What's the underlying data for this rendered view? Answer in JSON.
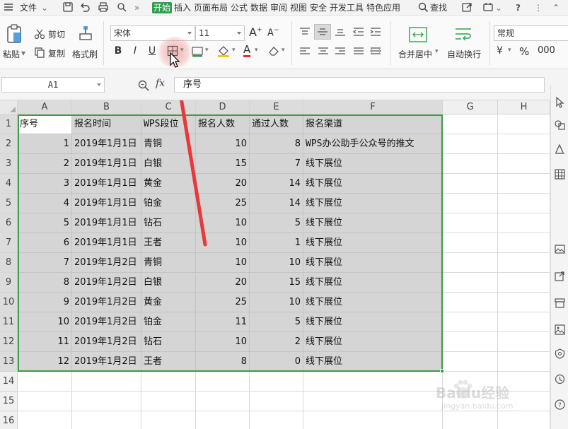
{
  "menubar": {
    "file_label": "文件",
    "tabs": [
      "开始",
      "插入",
      "页面布局",
      "公式",
      "数据",
      "审阅",
      "视图",
      "安全",
      "开发工具",
      "特色应用"
    ],
    "search_label": "查找"
  },
  "ribbon": {
    "paste_label": "粘贴",
    "cut_label": "剪切",
    "copy_label": "复制",
    "format_painter_label": "格式刷",
    "font_name": "宋体",
    "font_size": "11",
    "merge_center_label": "合并居中",
    "wrap_text_label": "自动换行",
    "number_format": "常规"
  },
  "formula_bar": {
    "name_box": "A1",
    "fx_label": "fx",
    "content": "序号"
  },
  "sheet": {
    "columns": [
      "A",
      "B",
      "C",
      "D",
      "E",
      "F",
      "G",
      "H"
    ],
    "rows": [
      "1",
      "2",
      "3",
      "4",
      "5",
      "6",
      "7",
      "8",
      "9",
      "10",
      "11",
      "12",
      "13",
      "14",
      "15",
      "16"
    ],
    "header": [
      "序号",
      "报名时间",
      "WPS段位",
      "报名人数",
      "通过人数",
      "报名渠道"
    ],
    "data": [
      [
        "1",
        "2019年1月1日",
        "青铜",
        "10",
        "8",
        "WPS办公助手公众号的推文"
      ],
      [
        "2",
        "2019年1月1日",
        "白银",
        "15",
        "7",
        "线下展位"
      ],
      [
        "3",
        "2019年1月1日",
        "黄金",
        "20",
        "14",
        "线下展位"
      ],
      [
        "4",
        "2019年1月1日",
        "铂金",
        "25",
        "14",
        "线下展位"
      ],
      [
        "5",
        "2019年1月1日",
        "钻石",
        "10",
        "5",
        "线下展位"
      ],
      [
        "6",
        "2019年1月1日",
        "王者",
        "10",
        "1",
        "线下展位"
      ],
      [
        "7",
        "2019年1月2日",
        "青铜",
        "10",
        "10",
        "线下展位"
      ],
      [
        "8",
        "2019年1月2日",
        "白银",
        "20",
        "15",
        "线下展位"
      ],
      [
        "9",
        "2019年1月2日",
        "黄金",
        "25",
        "10",
        "线下展位"
      ],
      [
        "10",
        "2019年1月2日",
        "铂金",
        "11",
        "5",
        "线下展位"
      ],
      [
        "11",
        "2019年1月2日",
        "钻石",
        "10",
        "2",
        "线下展位"
      ],
      [
        "12",
        "2019年1月2日",
        "王者",
        "8",
        "0",
        "线下展位"
      ]
    ]
  },
  "watermark": {
    "brand": "Baidu经验",
    "url": "jingyan.baidu.com"
  },
  "colors": {
    "accent_green": "#2e9e4f",
    "selection_border": "#3c9a4a",
    "arrow_red": "#e8383a"
  }
}
